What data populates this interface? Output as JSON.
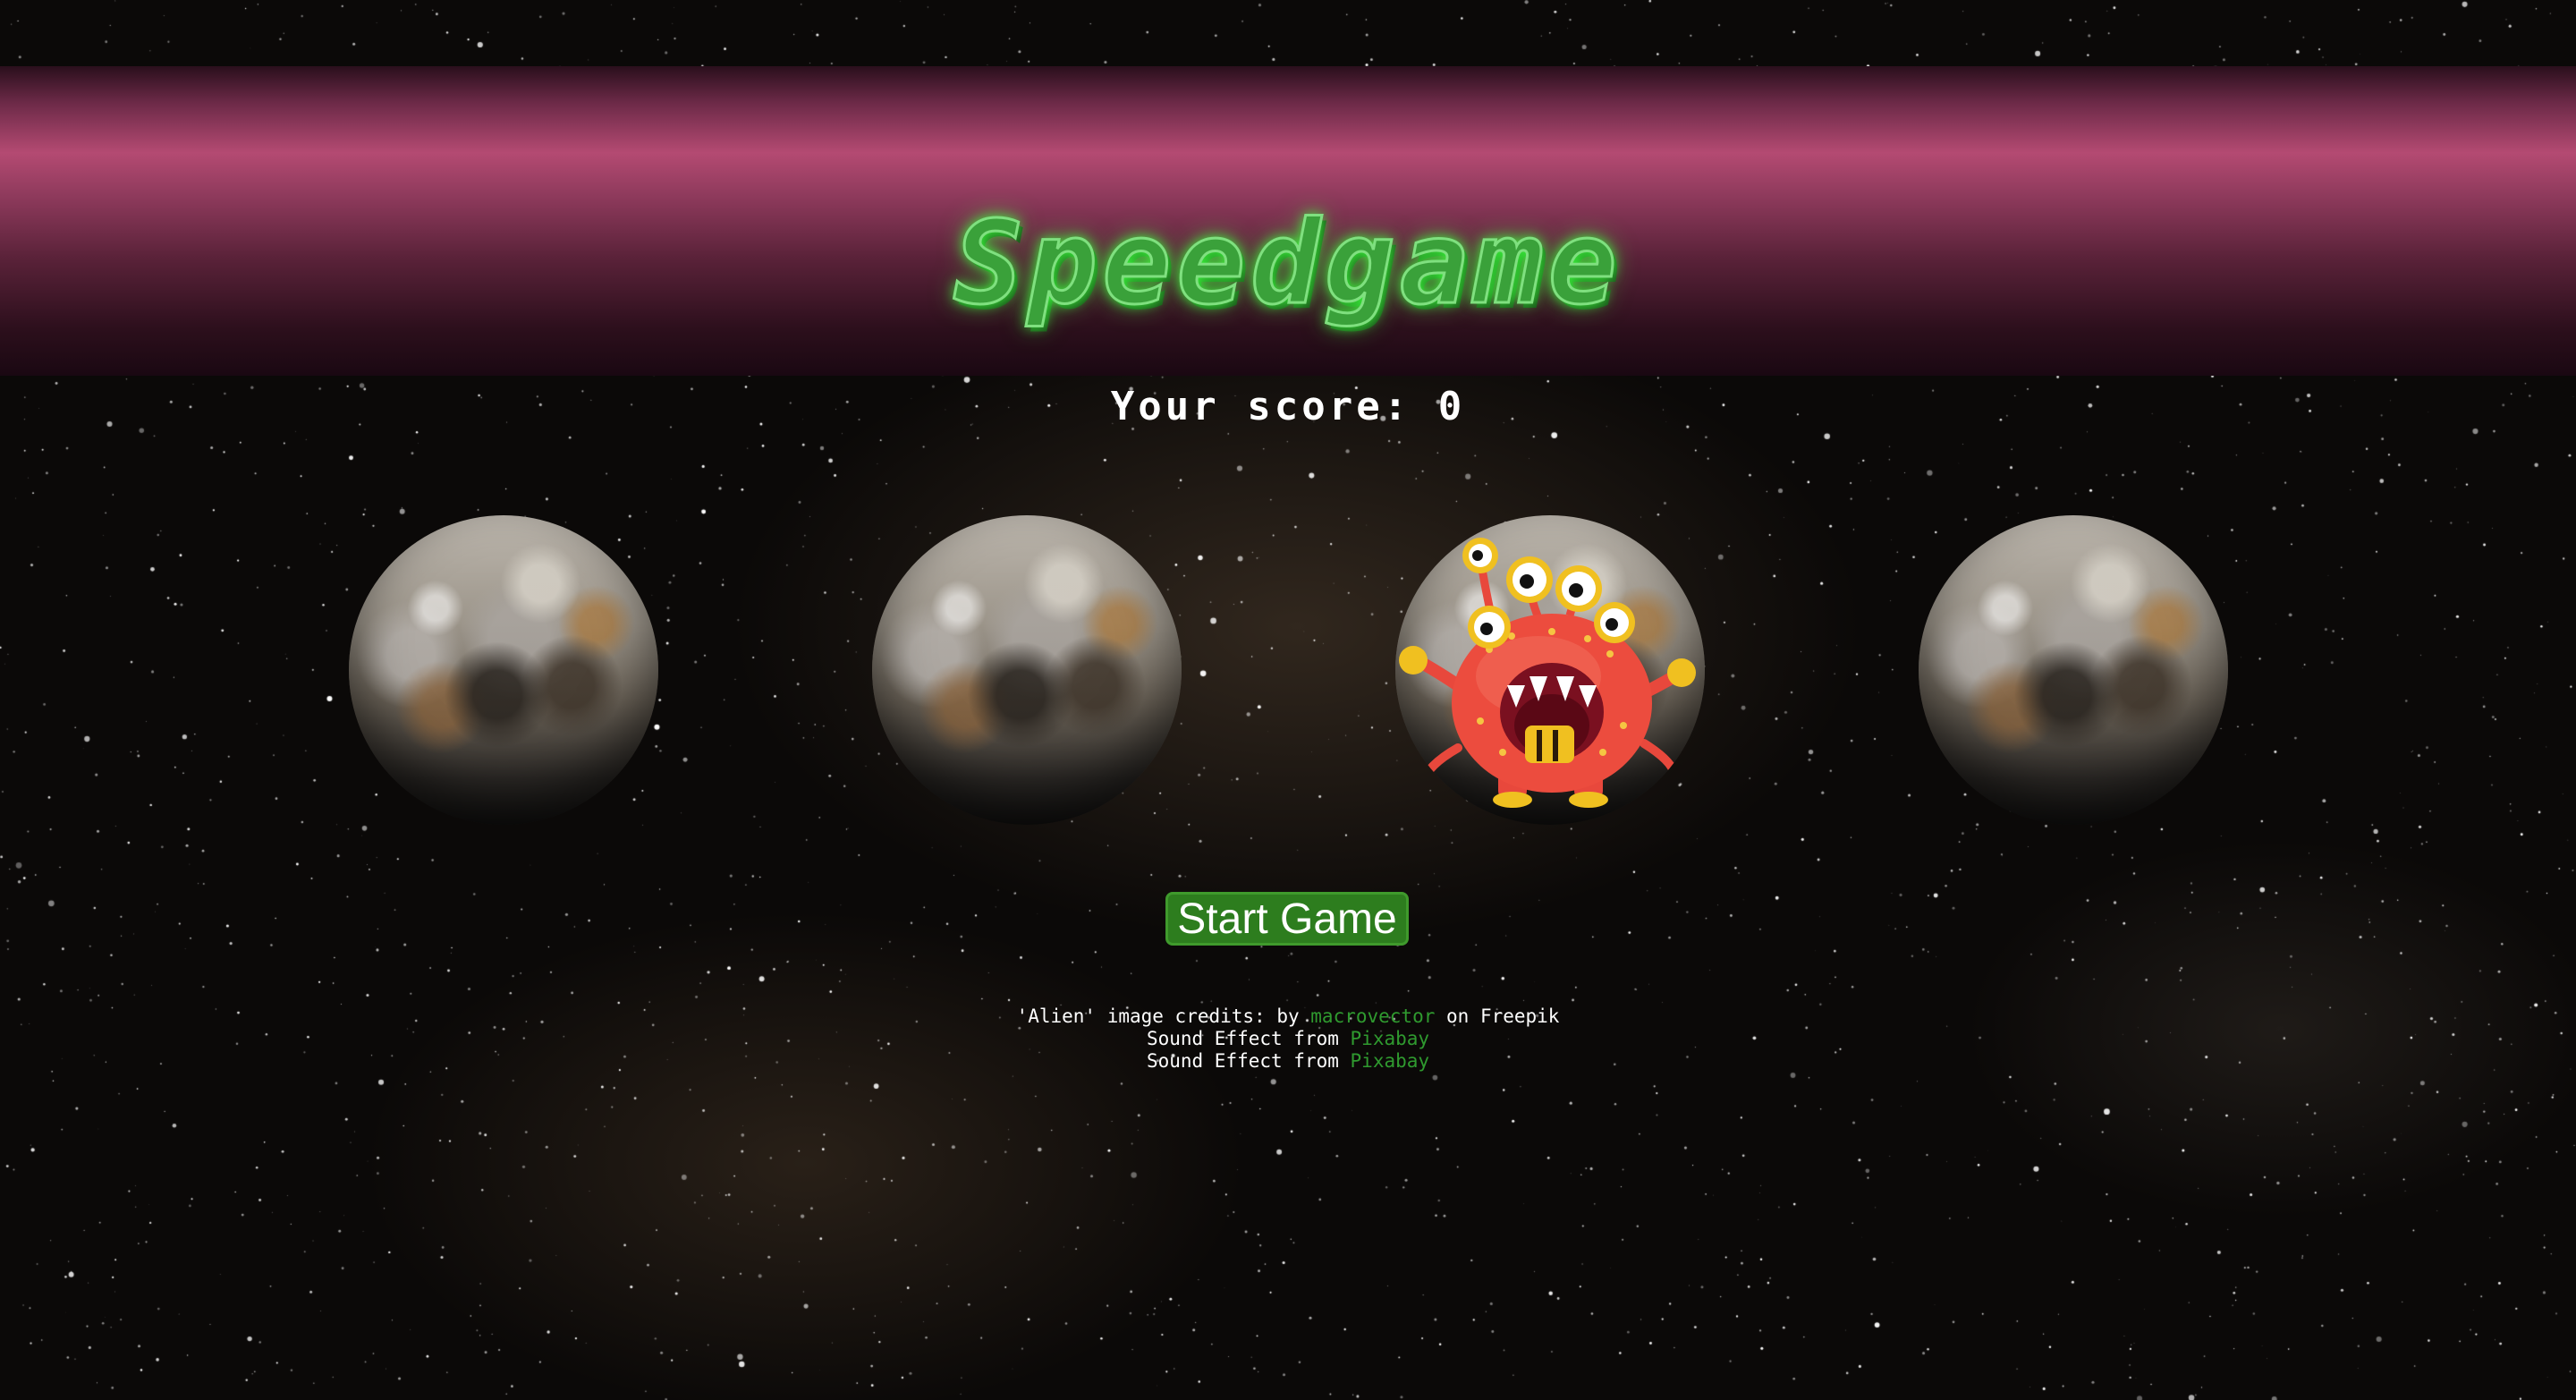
{
  "header": {
    "title": "Speedgame"
  },
  "score": {
    "label": "Your score:",
    "value": "0"
  },
  "circles": [
    {
      "name": "circle-1",
      "image": "moon-icon",
      "active": false
    },
    {
      "name": "circle-2",
      "image": "moon-icon",
      "active": false
    },
    {
      "name": "circle-3",
      "image": "moon-icon",
      "active": true,
      "overlay": "alien-icon"
    },
    {
      "name": "circle-4",
      "image": "moon-icon",
      "active": false
    }
  ],
  "controls": {
    "start_label": "Start Game"
  },
  "credits": {
    "line1_prefix": "'Alien' image credits: by",
    "line1_link": "macrovector",
    "line1_suffix": "on Freepik",
    "line2_prefix": "Sound Effect from",
    "line2_link": "Pixabay",
    "line3_prefix": "Sound Effect from",
    "line3_link": "Pixabay"
  },
  "colors": {
    "title": "#3aa13a",
    "banner": "#b44a72",
    "button": "#2d7d1e",
    "link": "#2f9a2f"
  }
}
